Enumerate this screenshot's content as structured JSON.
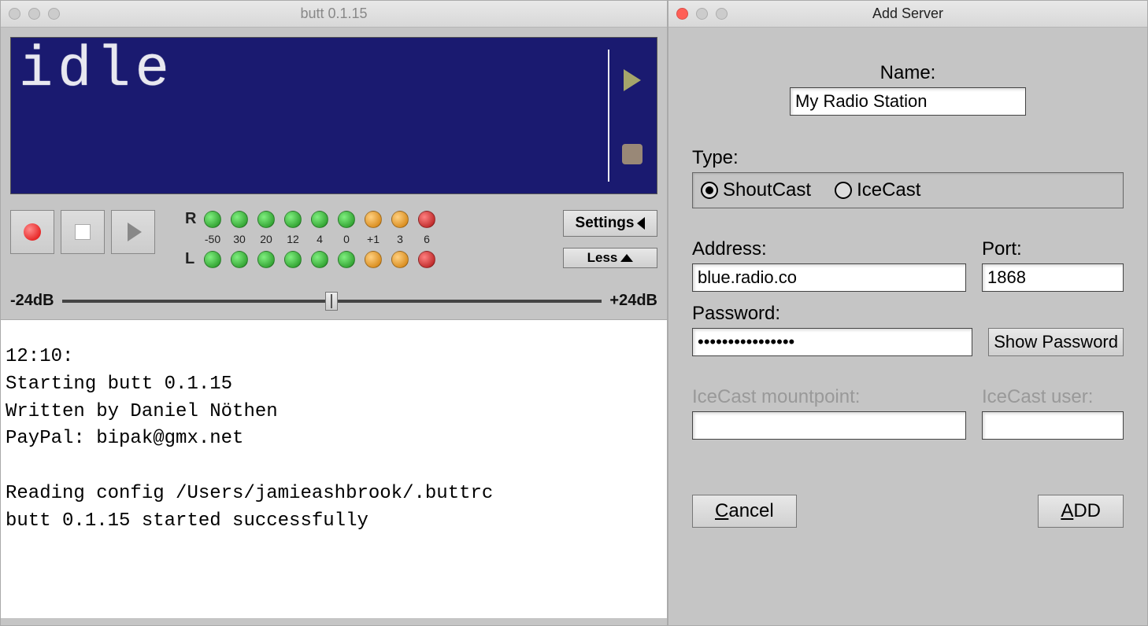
{
  "main": {
    "title": "butt 0.1.15",
    "lcd_status": "idle",
    "vu": {
      "channel_r": "R",
      "channel_l": "L",
      "scale": [
        "-50",
        "30",
        "20",
        "12",
        "4",
        "0",
        "+1",
        "3",
        "6"
      ]
    },
    "settings_btn": "Settings",
    "less_btn": "Less",
    "slider_min": "-24dB",
    "slider_max": "+24dB",
    "log": "12:10:\nStarting butt 0.1.15\nWritten by Daniel Nöthen\nPayPal: bipak@gmx.net\n\nReading config /Users/jamieashbrook/.buttrc\nbutt 0.1.15 started successfully"
  },
  "dialog": {
    "title": "Add Server",
    "name_label": "Name:",
    "name_value": "My Radio Station",
    "type_label": "Type:",
    "type_shoutcast": "ShoutCast",
    "type_icecast": "IceCast",
    "type_selected": "ShoutCast",
    "address_label": "Address:",
    "address_value": "blue.radio.co",
    "port_label": "Port:",
    "port_value": "1868",
    "password_label": "Password:",
    "password_value": "••••••••••••••••",
    "show_password": "Show Password",
    "mount_label": "IceCast mountpoint:",
    "mount_value": "",
    "user_label": "IceCast user:",
    "user_value": "",
    "cancel": "Cancel",
    "cancel_accel": "C",
    "add": "ADD",
    "add_accel": "A"
  }
}
